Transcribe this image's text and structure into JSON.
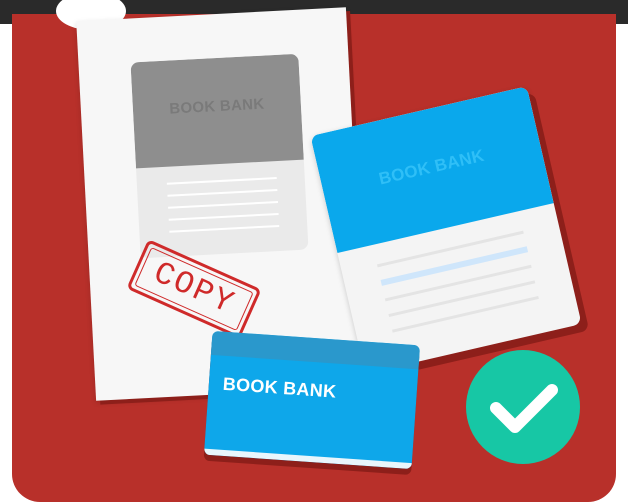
{
  "cards": {
    "copy_book_title": "BOOK BANK",
    "blue_book_title": "BOOK BANK",
    "passbook_title": "BOOK BANK"
  },
  "stamp": {
    "text": "COPY"
  },
  "icons": {
    "badge": "checkmark-icon"
  },
  "colors": {
    "background": "#b8302a",
    "blue_accent": "#0aa8ec",
    "stamp_red": "#cf2a2a",
    "badge_green": "#17c7a5"
  }
}
